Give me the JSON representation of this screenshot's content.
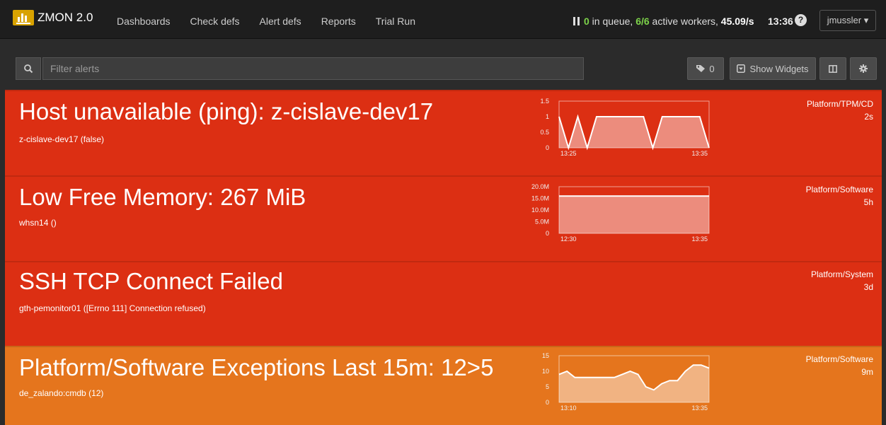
{
  "navbar": {
    "brand": "ZMON 2.0",
    "links": [
      "Dashboards",
      "Check defs",
      "Alert defs",
      "Reports",
      "Trial Run"
    ],
    "queue": {
      "count": "0",
      "in_queue_text": " in queue, ",
      "workers": "6/6",
      "workers_text": " active workers, ",
      "rate": "45.09/s"
    },
    "time": "13:36",
    "help": "?",
    "user": "jmussler ▾"
  },
  "toolbar": {
    "search_placeholder": "Filter alerts",
    "tag_count": "0",
    "show_widgets_label": "Show Widgets"
  },
  "colors": {
    "alert_red": "#dc2f13",
    "alert_orange": "#e5751d",
    "queue_green": "#7dd34a"
  },
  "alerts": [
    {
      "title": "Host unavailable (ping): z-cislave-dev17",
      "subtitle": "z-cislave-dev17 (false)",
      "team": "Platform/TPM/CD",
      "age": "2s",
      "severity": "red",
      "chart": {
        "y_ticks": [
          "1.5",
          "1",
          "0.5",
          "0"
        ],
        "x_ticks": [
          "13:25",
          "13:35"
        ],
        "ylim": [
          0,
          1.5
        ],
        "values": [
          1,
          0,
          1,
          0,
          1,
          1,
          1,
          1,
          1,
          1,
          0,
          1,
          1,
          1,
          1,
          1,
          0
        ]
      }
    },
    {
      "title": "Low Free Memory: 267 MiB",
      "subtitle": "whsn14 ()",
      "team": "Platform/Software",
      "age": "5h",
      "severity": "red",
      "chart": {
        "y_ticks": [
          "20.0M",
          "15.0M",
          "10.0M",
          "5.0M",
          "0"
        ],
        "x_ticks": [
          "12:30",
          "13:35"
        ],
        "ylim": [
          0,
          20000000
        ],
        "values": [
          16000000,
          16000000,
          16000000,
          16000000,
          16000000,
          16000000,
          16000000,
          16000000
        ]
      }
    },
    {
      "title": "SSH TCP Connect Failed",
      "subtitle": "gth-pemonitor01 ([Errno 111] Connection refused)",
      "team": "Platform/System",
      "age": "3d",
      "severity": "red",
      "chart": null
    },
    {
      "title": "Platform/Software Exceptions Last 15m: 12>5",
      "subtitle": "de_zalando:cmdb (12)",
      "team": "Platform/Software",
      "age": "9m",
      "severity": "orange",
      "chart": {
        "y_ticks": [
          "15",
          "10",
          "5",
          "0"
        ],
        "x_ticks": [
          "13:10",
          "13:35"
        ],
        "ylim": [
          0,
          15
        ],
        "values": [
          9,
          10,
          8,
          8,
          8,
          8,
          8,
          8,
          9,
          10,
          9,
          5,
          4,
          6,
          7,
          7,
          10,
          12,
          12,
          11
        ]
      }
    }
  ]
}
